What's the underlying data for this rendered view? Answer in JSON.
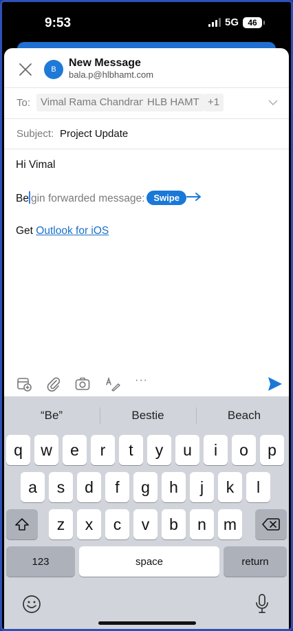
{
  "status": {
    "time": "9:53",
    "network": "5G",
    "battery": "46"
  },
  "compose": {
    "title": "New Message",
    "avatar_letter": "B",
    "from": "bala.p@hlbhamt.com",
    "to_label": "To:",
    "recipients": [
      "Vimal Rama Chandran",
      "HLB HAMT",
      "+1"
    ],
    "subject_label": "Subject:",
    "subject": "Project Update",
    "greeting": "Hi Vimal",
    "forward_typed_before": "Be",
    "forward_typed_after": "gin forwarded message:",
    "swipe_hint": "Swipe",
    "signature_prefix": "Get ",
    "signature_link": "Outlook for iOS"
  },
  "toolbar": {
    "icons": [
      "calendar-add-icon",
      "attachment-icon",
      "camera-icon",
      "draw-icon",
      "more-icon",
      "send-icon"
    ],
    "more_label": "···"
  },
  "keyboard": {
    "suggestions": [
      "“Be”",
      "Bestie",
      "Beach"
    ],
    "row1": [
      "q",
      "w",
      "e",
      "r",
      "t",
      "y",
      "u",
      "i",
      "o",
      "p"
    ],
    "row2": [
      "a",
      "s",
      "d",
      "f",
      "g",
      "h",
      "j",
      "k",
      "l"
    ],
    "row3": [
      "z",
      "x",
      "c",
      "v",
      "b",
      "n",
      "m"
    ],
    "numbers_label": "123",
    "space_label": "space",
    "return_label": "return"
  },
  "colors": {
    "accent": "#1a78d8",
    "link": "#1a6fcb",
    "keyboard_bg": "#d1d4db"
  }
}
